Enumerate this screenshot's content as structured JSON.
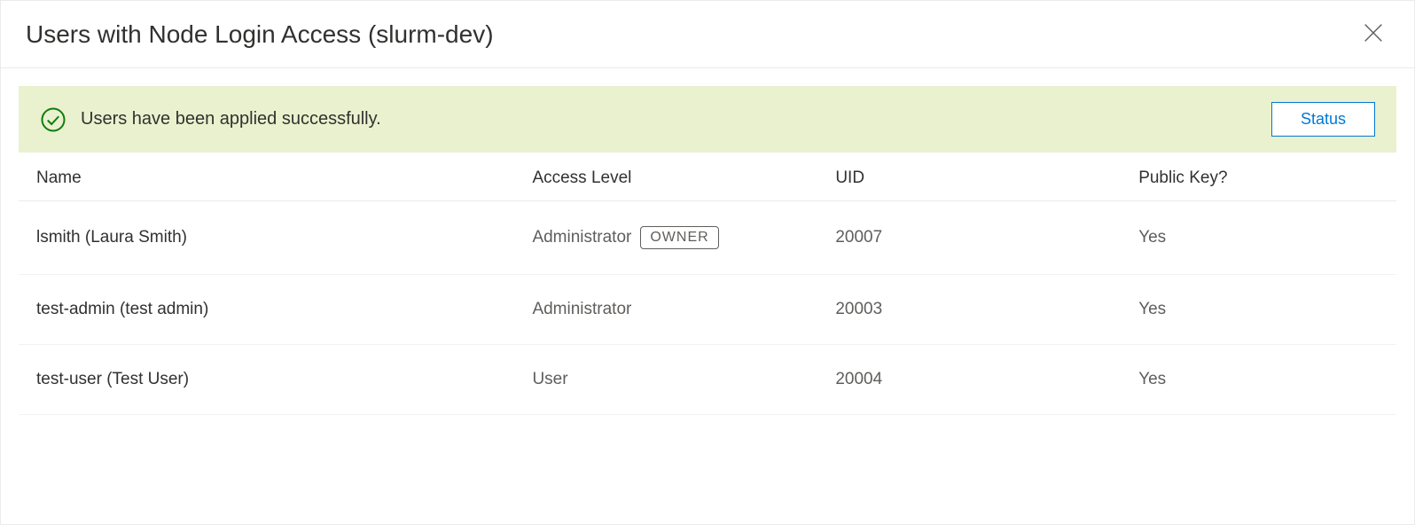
{
  "dialog": {
    "title": "Users with Node Login Access (slurm-dev)"
  },
  "banner": {
    "message": "Users have been applied successfully.",
    "status_button": "Status"
  },
  "table": {
    "headers": {
      "name": "Name",
      "access": "Access Level",
      "uid": "UID",
      "pubkey": "Public Key?"
    },
    "rows": [
      {
        "name": "lsmith (Laura Smith)",
        "access": "Administrator",
        "owner_badge": "OWNER",
        "uid": "20007",
        "pubkey": "Yes"
      },
      {
        "name": "test-admin (test admin)",
        "access": "Administrator",
        "owner_badge": "",
        "uid": "20003",
        "pubkey": "Yes"
      },
      {
        "name": "test-user (Test User)",
        "access": "User",
        "owner_badge": "",
        "uid": "20004",
        "pubkey": "Yes"
      }
    ]
  }
}
